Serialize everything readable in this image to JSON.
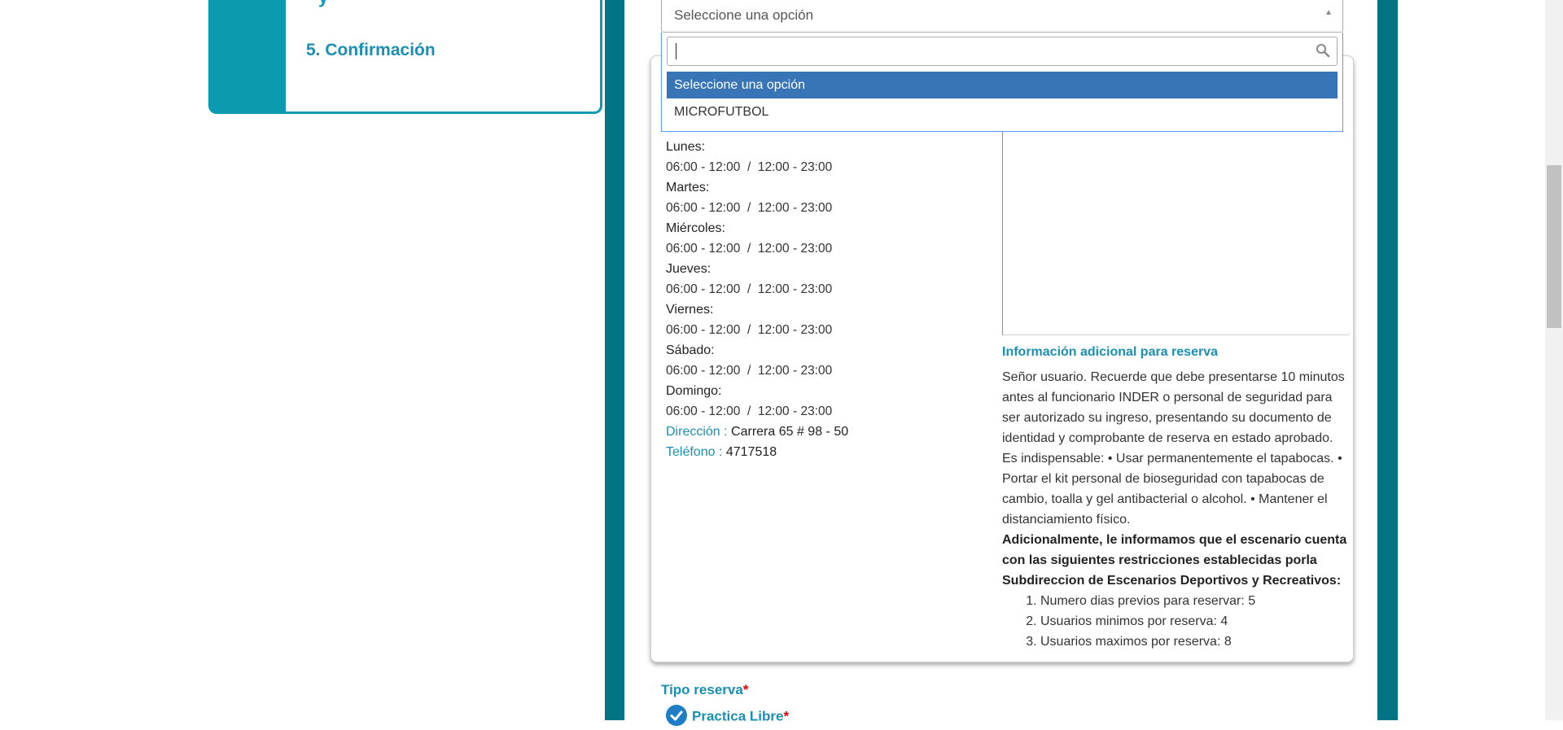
{
  "steps": {
    "partial_label": "y",
    "confirmation_label": "5. Confirmación"
  },
  "select": {
    "value": "Seleccione una opción",
    "search_value": "",
    "options": [
      {
        "label": "Seleccione una opción",
        "highlighted": true
      },
      {
        "label": "MICROFUTBOL",
        "highlighted": false
      }
    ]
  },
  "schedule": [
    {
      "day": "Lunes:",
      "hours": "06:00 - 12:00  /  12:00 - 23:00"
    },
    {
      "day": "Martes:",
      "hours": "06:00 - 12:00  /  12:00 - 23:00"
    },
    {
      "day": "Miércoles:",
      "hours": "06:00 - 12:00  /  12:00 - 23:00"
    },
    {
      "day": "Jueves:",
      "hours": "06:00 - 12:00  /  12:00 - 23:00"
    },
    {
      "day": "Viernes:",
      "hours": "06:00 - 12:00  /  12:00 - 23:00"
    },
    {
      "day": "Sábado:",
      "hours": "06:00 - 12:00  /  12:00 - 23:00"
    },
    {
      "day": "Domingo:",
      "hours": "06:00 - 12:00  /  12:00 - 23:00"
    }
  ],
  "contact": {
    "address_label": "Dirección :",
    "address_value": "Carrera 65 # 98 - 50",
    "phone_label": "Teléfono :",
    "phone_value": "4717518"
  },
  "info": {
    "title": "Información adicional para reserva",
    "body": "Señor usuario. Recuerde que debe presentarse 10 minutos antes al funcionario INDER o personal de seguridad para ser autorizado su ingreso, presentando su documento de identidad y comprobante de reserva en estado aprobado. Es indispensable: • Usar permanentemente el tapabocas. • Portar el kit personal de bioseguridad con tapabocas de cambio, toalla y gel antibacterial o alcohol. • Mantener el distanciamiento físico.",
    "restrictions_intro": "Adicionalmente, le informamos que el escenario cuenta con las siguientes restricciones establecidas porla Subdireccion de Escenarios Deportivos y Recreativos:",
    "restrictions": [
      "Numero dias previos para reservar: 5",
      "Usuarios minimos por reserva: 4",
      "Usuarios maximos por reserva: 8"
    ]
  },
  "reservation": {
    "type_label": "Tipo reserva",
    "required_mark": "*",
    "option_label": "Practica Libre"
  },
  "colors": {
    "accent": "#0b9ab0",
    "frame": "#037483",
    "highlight": "#3875b7",
    "required": "#e00000"
  }
}
